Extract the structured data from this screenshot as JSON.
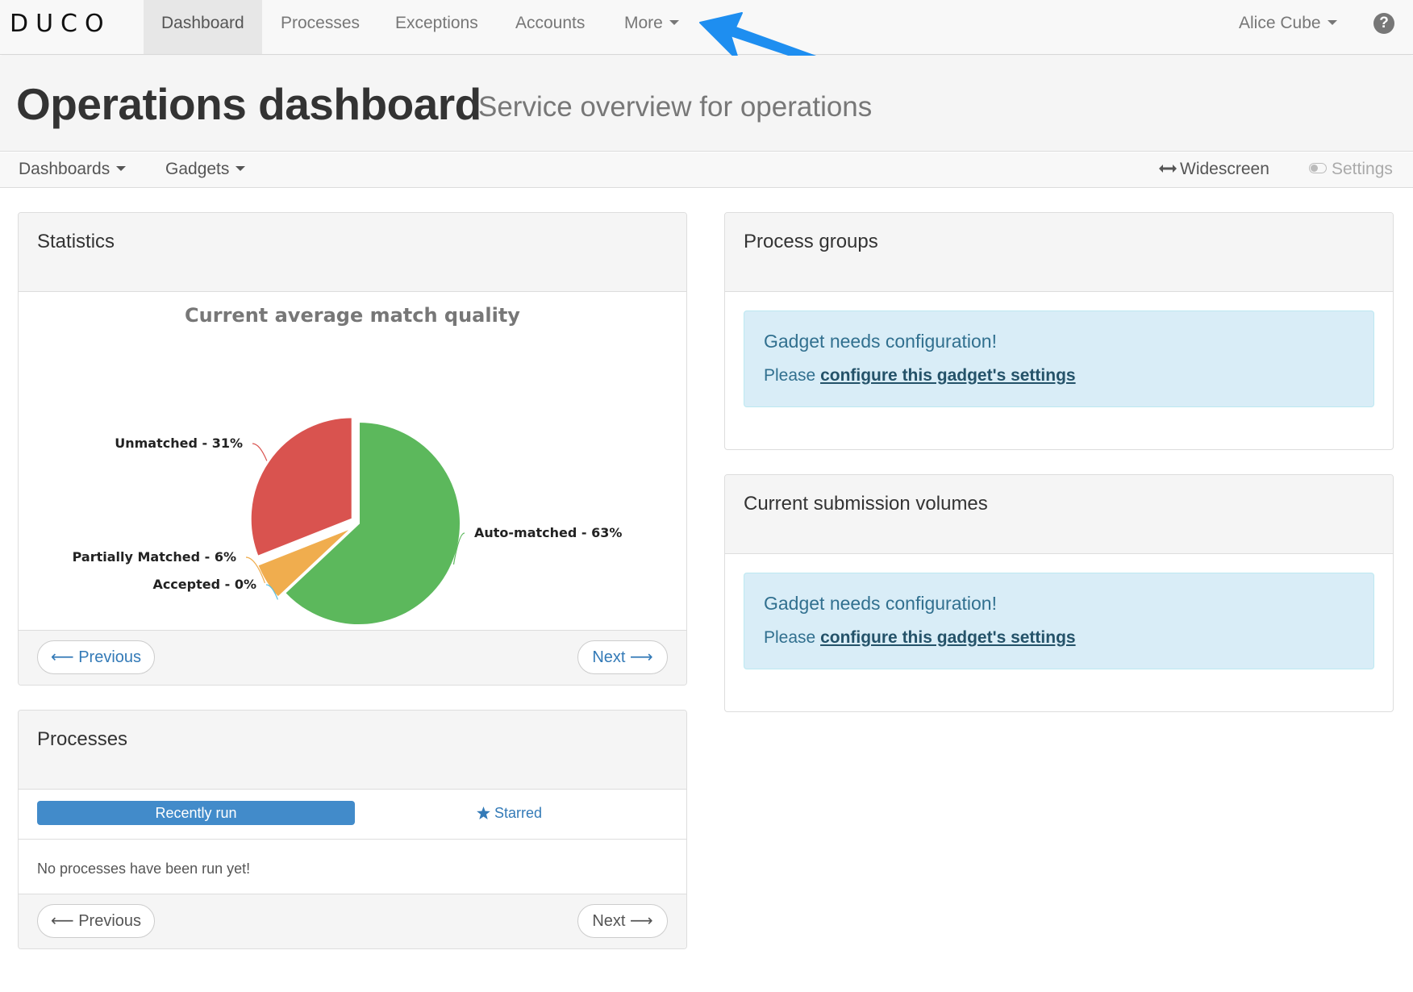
{
  "nav": {
    "logo": "DUCO",
    "items": [
      {
        "label": "Dashboard"
      },
      {
        "label": "Processes"
      },
      {
        "label": "Exceptions"
      },
      {
        "label": "Accounts"
      },
      {
        "label": "More"
      }
    ],
    "user": "Alice Cube",
    "help": "?"
  },
  "header": {
    "title": "Operations dashboard",
    "subtitle": "Service overview for operations"
  },
  "subbar": {
    "dashboards": "Dashboards",
    "gadgets": "Gadgets",
    "widescreen": "Widescreen",
    "settings": "Settings"
  },
  "statistics": {
    "title": "Statistics",
    "previous": "Previous",
    "next": "Next"
  },
  "chart_data": {
    "type": "pie",
    "title": "Current average match quality",
    "slices": [
      {
        "label": "Auto-matched - 63%",
        "value": 63,
        "color": "#5cb85c"
      },
      {
        "label": "Accepted - 0%",
        "value": 0,
        "color": "#5bc0de"
      },
      {
        "label": "Partially Matched - 6%",
        "value": 6,
        "color": "#f0ad4e"
      },
      {
        "label": "Unmatched - 31%",
        "value": 31,
        "color": "#d9534f"
      }
    ]
  },
  "processes": {
    "title": "Processes",
    "tab_recent": "Recently run",
    "tab_starred": "Starred",
    "empty": "No processes have been run yet!",
    "previous": "Previous",
    "next": "Next"
  },
  "process_groups": {
    "title": "Process groups",
    "alert_title": "Gadget needs configuration!",
    "alert_prefix": "Please",
    "alert_link": "configure this gadget's settings"
  },
  "submission_volumes": {
    "title": "Current submission volumes",
    "alert_title": "Gadget needs configuration!",
    "alert_prefix": "Please",
    "alert_link": "configure this gadget's settings"
  },
  "colors": {
    "primary": "#428bca",
    "link": "#337ab7",
    "alert_bg": "#d9edf7",
    "annotation_arrow": "#1e8ef0"
  }
}
